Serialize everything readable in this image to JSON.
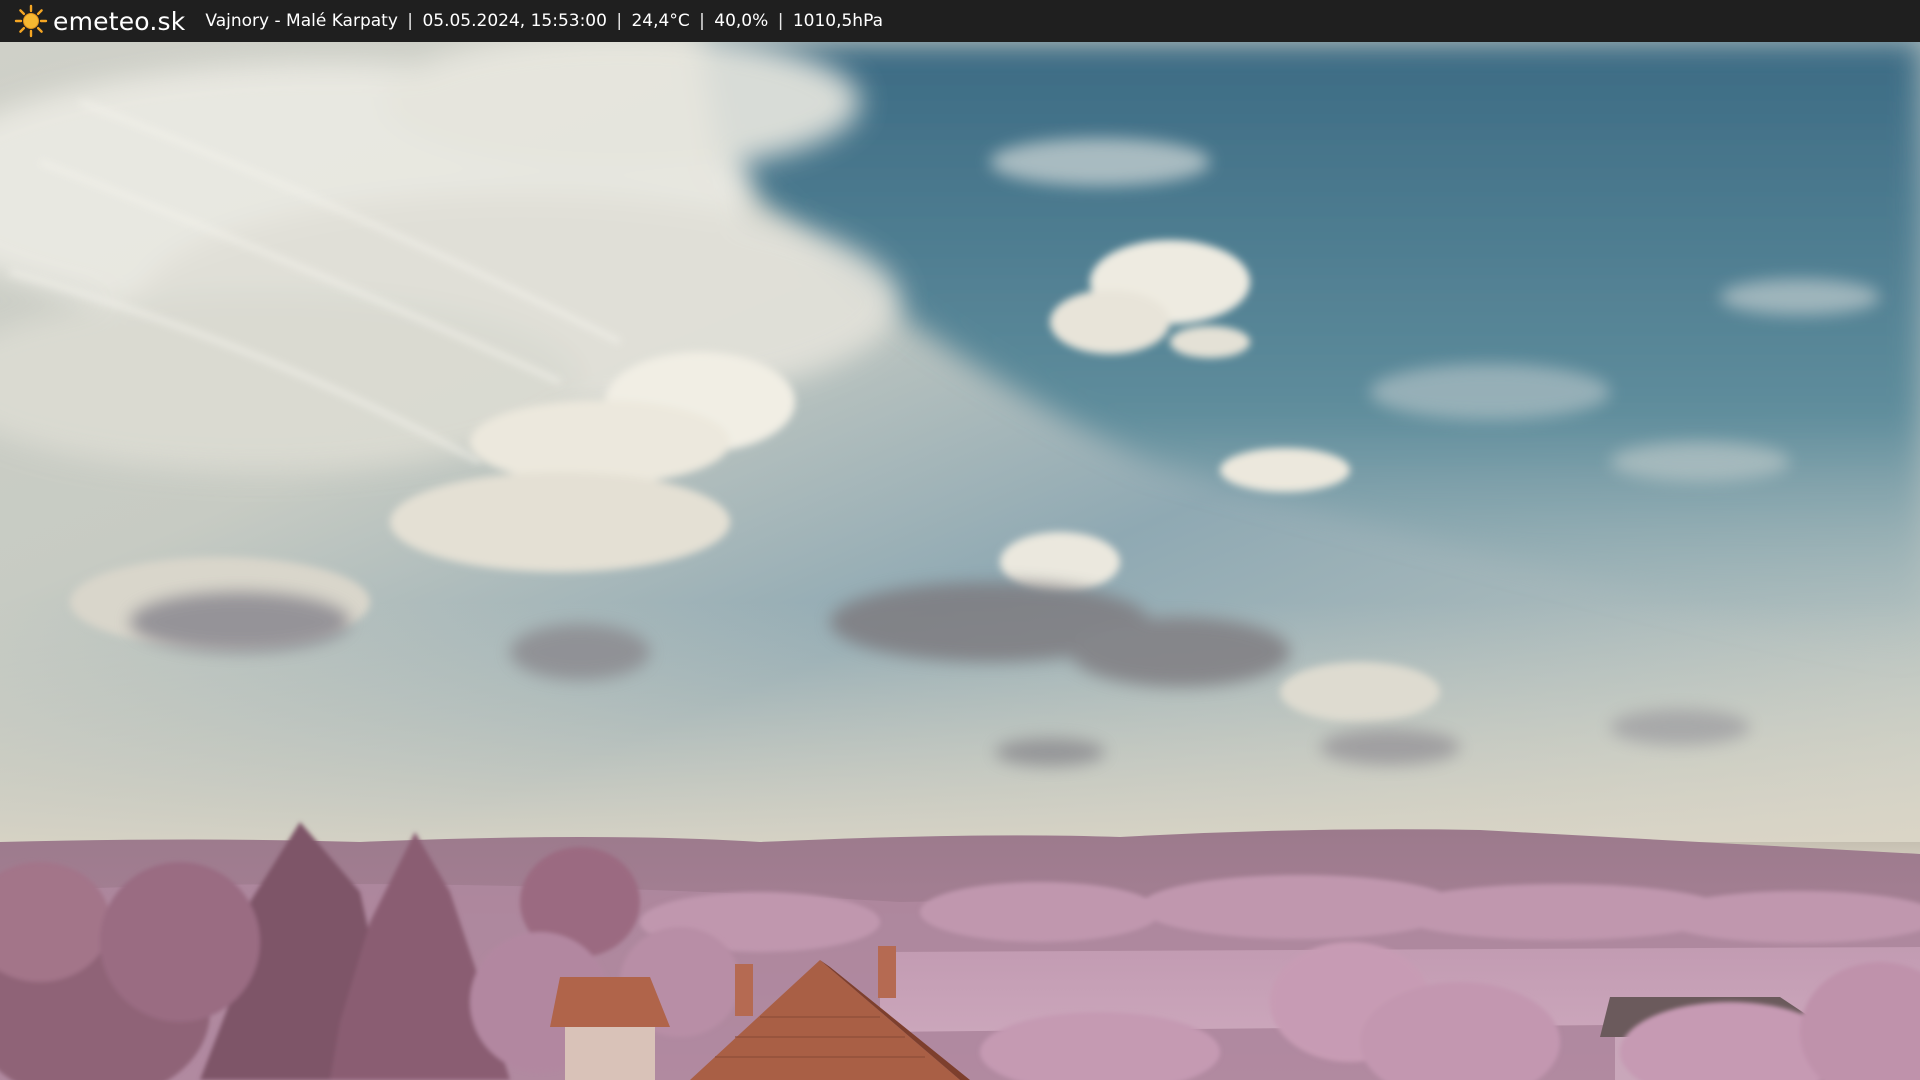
{
  "header": {
    "brand": "emeteo.sk",
    "logo_icon": "sun-icon",
    "location": "Vajnory - Malé Karpaty",
    "datetime": "05.05.2024, 15:53:00",
    "temperature": "24,4°C",
    "humidity": "40,0%",
    "pressure": "1010,5hPa",
    "separator": "|"
  },
  "colors": {
    "bar_background": "#1f1f1f",
    "sun": "#f5a623",
    "sky_deep": "#3f6f86",
    "cloud": "#e9e6dc",
    "hills": "#a57a96",
    "roof": "#a9624a"
  }
}
